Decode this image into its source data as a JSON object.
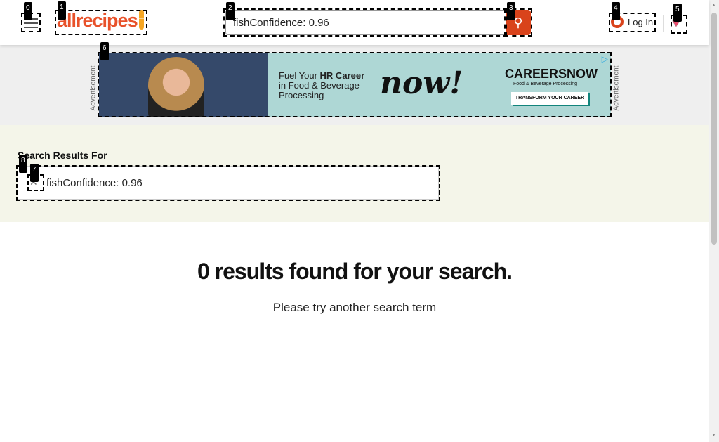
{
  "header": {
    "logo": "allrecipes",
    "search_value": "fishConfidence: 0.96",
    "search_icon": "magnifier",
    "login_label": "Log In",
    "menu_icon": "hamburger",
    "heart_icon": "heart"
  },
  "ad": {
    "side_label": "Advertisement",
    "headline_pre": "Fuel Your ",
    "headline_bold": "HR Career",
    "headline_rest": "in Food & Beverage Processing",
    "now": "now!",
    "brand": "CAREERSNOW",
    "brand_sub": "Food & Beverage Processing",
    "cta": "TRANSFORM YOUR CAREER"
  },
  "results": {
    "heading": "Search Results For",
    "query": "fishConfidence: 0.96",
    "clear_icon": "close"
  },
  "main": {
    "title": "0 results found for your search.",
    "subtitle": "Please try another search term"
  },
  "annotations": [
    "0",
    "1",
    "2",
    "3",
    "4",
    "5",
    "6",
    "7",
    "8"
  ]
}
